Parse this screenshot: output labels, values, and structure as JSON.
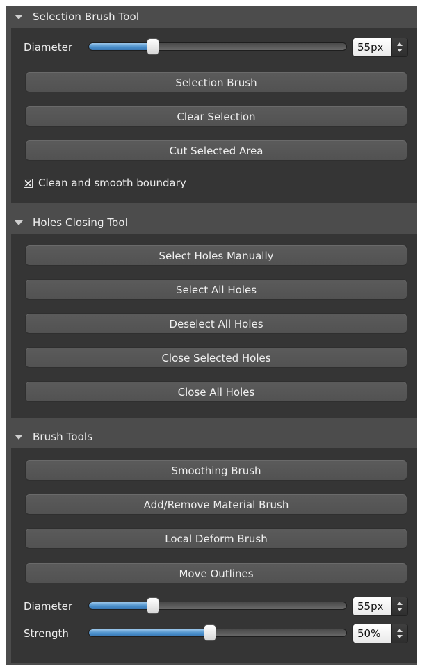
{
  "sections": {
    "selection_brush": {
      "title": "Selection Brush Tool",
      "diameter": {
        "label": "Diameter",
        "value": "55px",
        "level": 0.25
      },
      "buttons": [
        "Selection Brush",
        "Clear Selection",
        "Cut Selected Area"
      ],
      "checkbox": {
        "label": "Clean and smooth boundary",
        "checked": true
      }
    },
    "holes_closing": {
      "title": "Holes Closing Tool",
      "buttons": [
        "Select Holes Manually",
        "Select All Holes",
        "Deselect All Holes",
        "Close Selected Holes",
        "Close All Holes"
      ]
    },
    "brush_tools": {
      "title": "Brush Tools",
      "buttons": [
        "Smoothing Brush",
        "Add/Remove Material Brush",
        "Local Deform Brush",
        "Move Outlines"
      ],
      "diameter": {
        "label": "Diameter",
        "value": "55px",
        "level": 0.25
      },
      "strength": {
        "label": "Strength",
        "value": "50%",
        "level": 0.47
      }
    }
  },
  "colors": {
    "panel_bg": "#4c4c4c",
    "section_bg": "#353535",
    "button_bg": "#555555",
    "slider_fill": "#4a8fcb"
  },
  "icons": {
    "section_toggle": "triangle-down-icon",
    "spinner": "spinner-arrows-icon",
    "checkbox": "checkbox-checked-icon"
  }
}
